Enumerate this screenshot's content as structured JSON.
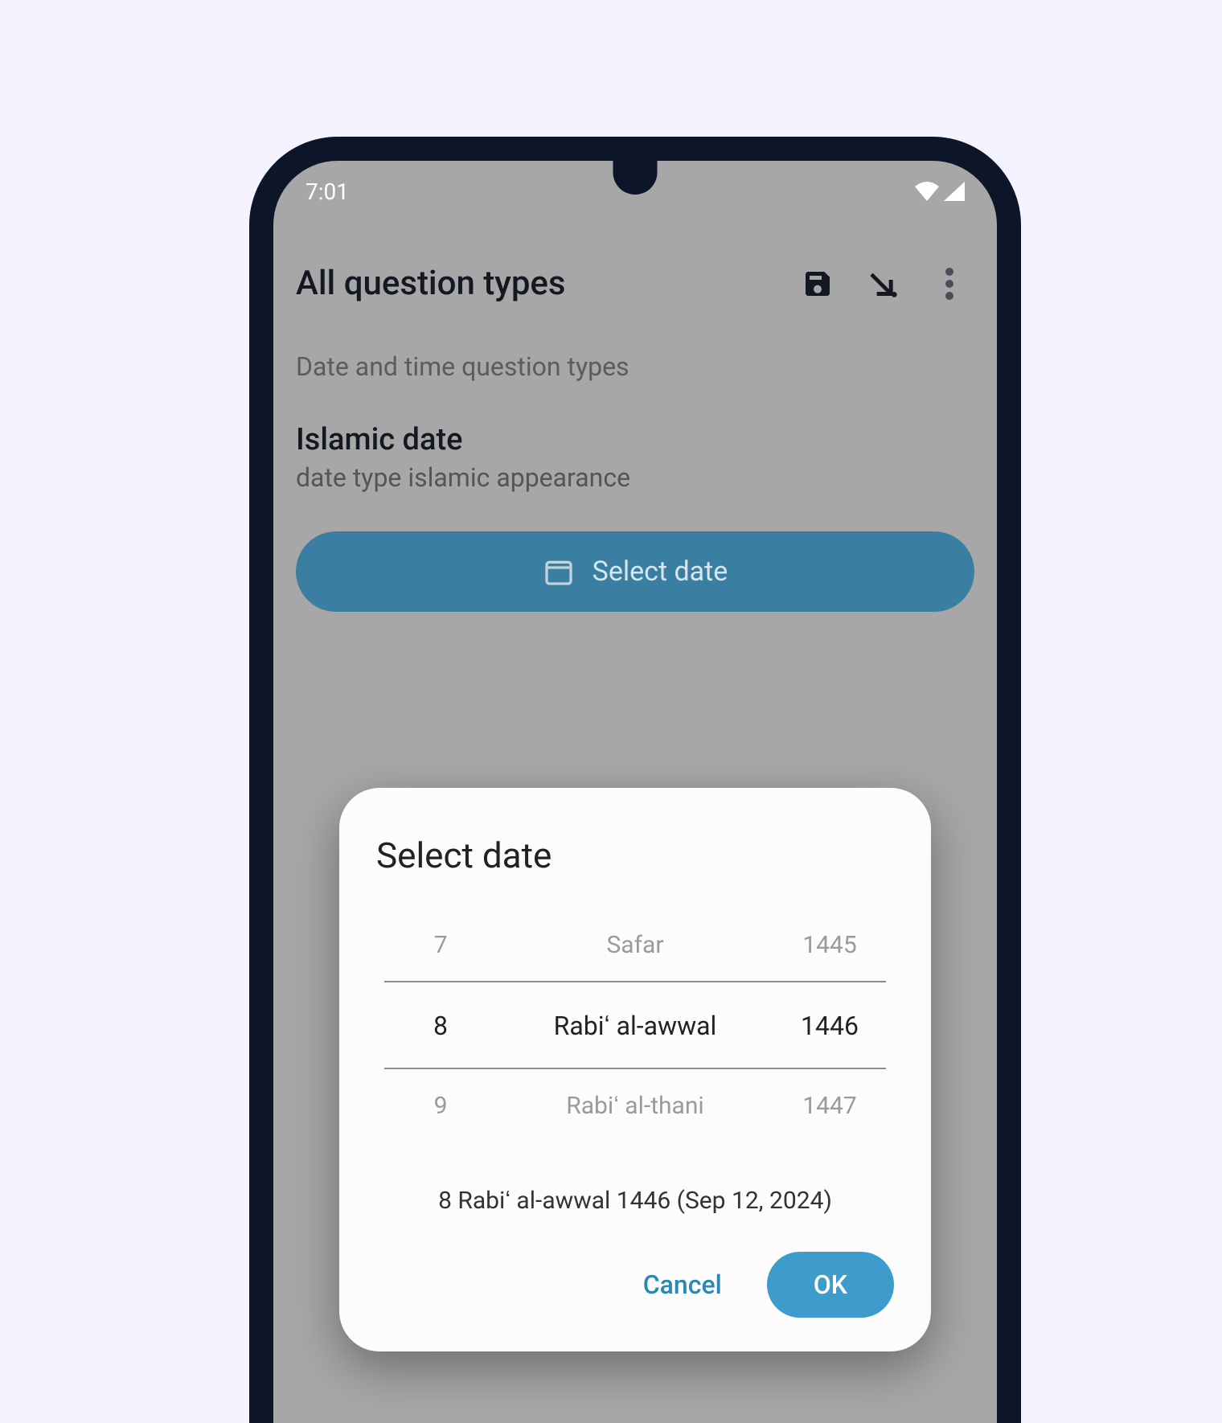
{
  "status": {
    "time": "7:01"
  },
  "appbar": {
    "title": "All question types"
  },
  "section": {
    "label": "Date and time question types"
  },
  "question": {
    "title": "Islamic date",
    "subtitle": "date type islamic appearance",
    "button_label": "Select date"
  },
  "dialog": {
    "title": "Select date",
    "spinner": {
      "day": {
        "prev": "7",
        "current": "8",
        "next": "9"
      },
      "month": {
        "prev": "Safar",
        "current": "Rabiʻ al-awwal",
        "next": "Rabiʻ al-thani"
      },
      "year": {
        "prev": "1445",
        "current": "1446",
        "next": "1447"
      }
    },
    "combined": "8 Rabiʻ al-awwal 1446 (Sep 12, 2024)",
    "cancel": "Cancel",
    "ok": "OK"
  }
}
